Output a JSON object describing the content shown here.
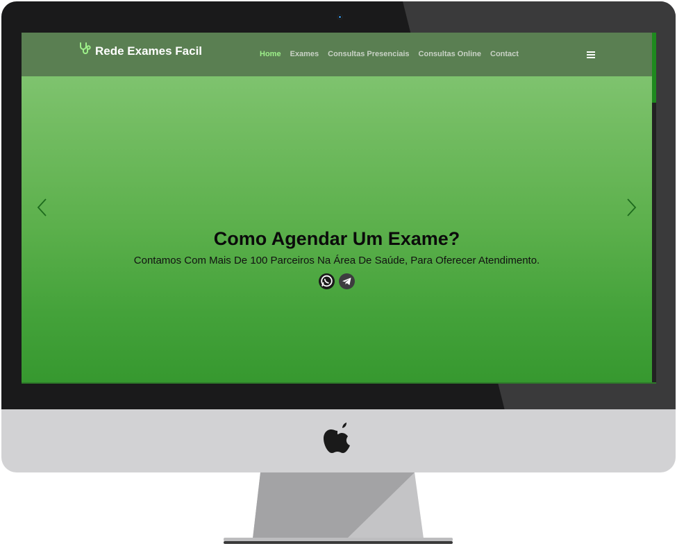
{
  "brand": {
    "name": "Rede Exames Facil",
    "icon": "stethoscope-icon"
  },
  "nav": {
    "items": [
      {
        "label": "Home",
        "active": true
      },
      {
        "label": "Exames",
        "active": false
      },
      {
        "label": "Consultas Presenciais",
        "active": false
      },
      {
        "label": "Consultas Online",
        "active": false
      },
      {
        "label": "Contact",
        "active": false
      }
    ],
    "menu_icon": "hamburger-menu-icon"
  },
  "hero": {
    "title": "Como Agendar Um Exame?",
    "subtitle": "Contamos Com Mais De 100 Parceiros Na Área De Saúde, Para Oferecer Atendimento.",
    "buttons": [
      {
        "icon": "whatsapp-icon"
      },
      {
        "icon": "telegram-icon"
      }
    ]
  },
  "carousel": {
    "prev_icon": "chevron-left-icon",
    "next_icon": "chevron-right-icon"
  },
  "colors": {
    "nav_bg": "#5a7f52",
    "active_link": "#9ef08a",
    "hero_top": "#89c97a",
    "hero_bottom": "#36982f",
    "scroll_thumb": "#1e8a1e"
  }
}
